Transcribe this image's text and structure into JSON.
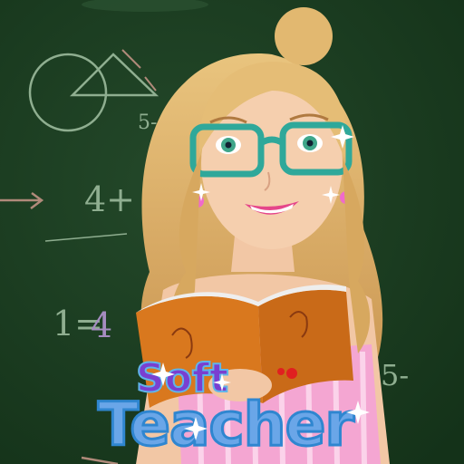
{
  "game": {
    "title_line1": "Soft",
    "title_line2": "Teacher",
    "chalk_notes": [
      "5-",
      "4+",
      "1=",
      "4",
      "5-"
    ]
  },
  "colors": {
    "chalkboard": "#1c3d22",
    "chalk": "#8fae90",
    "title_soft": "#7a3fd0",
    "title_teacher": "#6aa6e8",
    "title_outline": "#3d8fd8",
    "hair": "#e2b870",
    "glasses": "#2fa89a",
    "book": "#d9781e",
    "dress": "#f4a6d2"
  }
}
